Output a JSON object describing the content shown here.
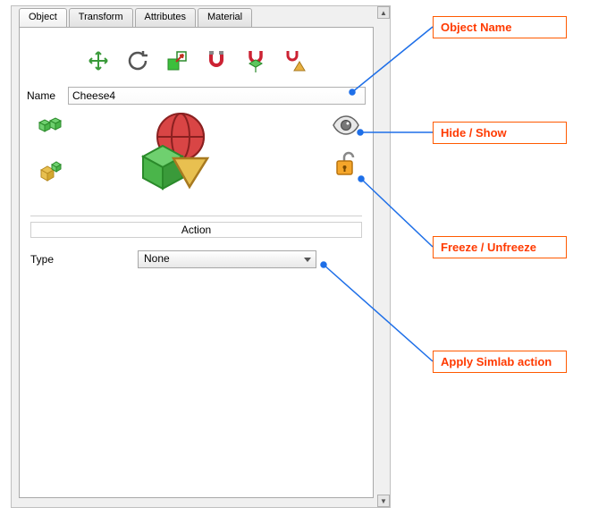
{
  "tabs": {
    "t0": "Object",
    "t1": "Transform",
    "t2": "Attributes",
    "t3": "Material"
  },
  "toolbar_icons": {
    "move": "move-icon",
    "rotate": "rotate-icon",
    "scale": "scale-icon",
    "snap": "snap-icon",
    "snap_object": "snap-object-icon",
    "snap_align": "snap-align-icon"
  },
  "name_field": {
    "label": "Name",
    "value": "Cheese4"
  },
  "side_icons": {
    "assembly": "assembly-icon",
    "explode": "explode-icon",
    "eye": "eye-icon",
    "lock": "lock-icon"
  },
  "action": {
    "header": "Action",
    "type_label": "Type",
    "type_value": "None"
  },
  "callouts": {
    "c1": "Object Name",
    "c2": "Hide / Show",
    "c3": "Freeze / Unfreeze",
    "c4": "Apply Simlab action"
  }
}
